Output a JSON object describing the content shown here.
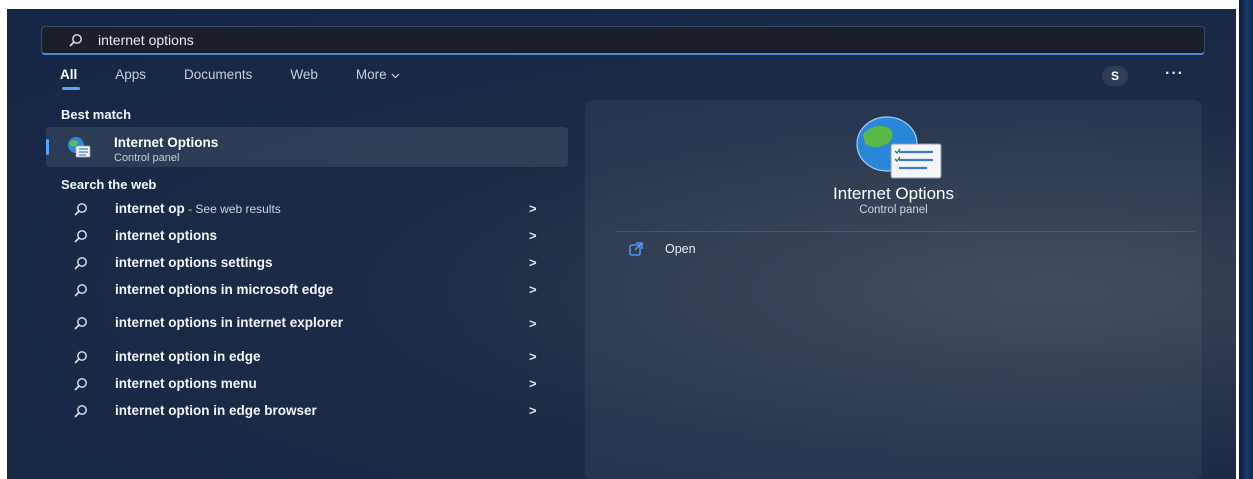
{
  "search": {
    "value": "internet options"
  },
  "tabs": [
    {
      "label": "All",
      "active": true
    },
    {
      "label": "Apps"
    },
    {
      "label": "Documents"
    },
    {
      "label": "Web"
    },
    {
      "label": "More"
    }
  ],
  "user": {
    "initial": "S"
  },
  "overflow_label": "···",
  "best_match": {
    "heading": "Best match",
    "title": "Internet Options",
    "subtitle": "Control panel"
  },
  "web": {
    "heading": "Search the web",
    "items": [
      {
        "label": "internet op",
        "hint": " - See web results"
      },
      {
        "label": "internet options"
      },
      {
        "label": "internet options settings"
      },
      {
        "label": "internet options in microsoft edge"
      },
      {
        "label": "internet options in internet explorer"
      },
      {
        "label": "internet option in edge"
      },
      {
        "label": "internet options menu"
      },
      {
        "label": "internet option in edge browser"
      }
    ],
    "chevron": ">"
  },
  "preview": {
    "title": "Internet Options",
    "subtitle": "Control panel",
    "action_label": "Open"
  },
  "colors": {
    "accent": "#5aa3ff",
    "background": "#1d2b45"
  }
}
